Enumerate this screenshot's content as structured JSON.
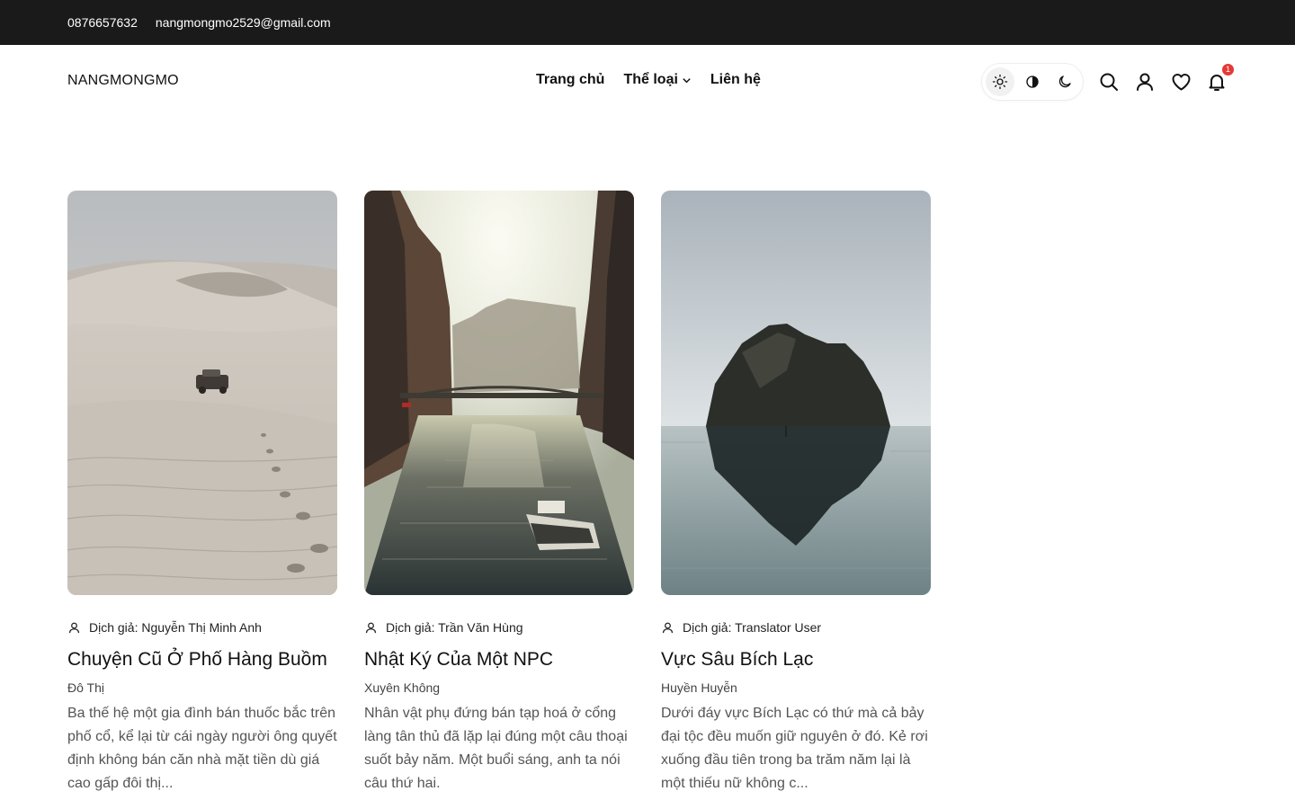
{
  "topbar": {
    "phone": "0876657632",
    "email": "nangmongmo2529@gmail.com"
  },
  "header": {
    "logo": "NANGMONGMO",
    "nav": [
      {
        "label": "Trang chủ"
      },
      {
        "label": "Thể loại"
      },
      {
        "label": "Liên hệ"
      }
    ],
    "theme_modes": [
      "light-icon",
      "contrast-icon",
      "moon-icon"
    ],
    "notifications_count": "1"
  },
  "cards": [
    {
      "translator_label": "Dịch giả: Nguyễn Thị Minh Anh",
      "title": "Chuyện Cũ Ở Phố Hàng Buồm",
      "category": "Đô Thị",
      "description": "Ba thế hệ một gia đình bán thuốc bắc trên phố cổ, kể lại từ cái ngày người ông quyết định không bán căn nhà mặt tiền dù giá cao gấp đôi thị..."
    },
    {
      "translator_label": "Dịch giả: Trần Văn Hùng",
      "title": "Nhật Ký Của Một NPC",
      "category": "Xuyên Không",
      "description": "Nhân vật phụ đứng bán tạp hoá ở cổng làng tân thủ đã lặp lại đúng một câu thoại suốt bảy năm. Một buổi sáng, anh ta nói câu thứ hai."
    },
    {
      "translator_label": "Dịch giả: Translator User",
      "title": "Vực Sâu Bích Lạc",
      "category": "Huyền Huyễn",
      "description": "Dưới đáy vực Bích Lạc có thứ mà cả bảy đại tộc đều muốn giữ nguyên ở đó. Kẻ rơi xuống đầu tiên trong ba trăm năm lại là một thiếu nữ không c..."
    }
  ],
  "colors": {
    "topbar_bg": "#1a1a1a",
    "badge": "#e53935",
    "text": "#111111",
    "muted": "#555555"
  }
}
